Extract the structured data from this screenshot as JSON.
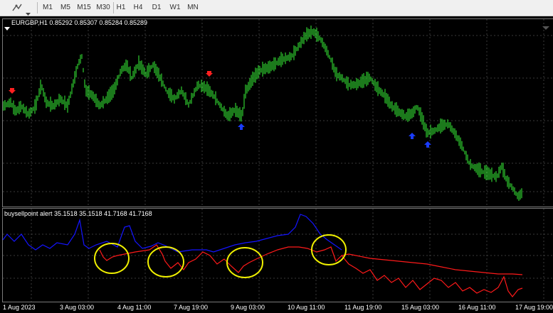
{
  "toolbar": {
    "timeframes": [
      "M1",
      "M5",
      "M15",
      "M30",
      "H1",
      "H4",
      "D1",
      "W1",
      "MN"
    ],
    "tools": [
      "draw-tools-icon",
      "chevron-down-icon"
    ]
  },
  "main_chart": {
    "symbol_info": "EURGBP,H1  0.85292 0.85307 0.85284 0.85289",
    "colors": {
      "candle": "#2ecc2e",
      "up_arrow": "#1a3cff",
      "down_arrow": "#ff2020",
      "grid": "#3a3a3a"
    }
  },
  "indicator": {
    "info": "buysellpoint alert 35.1518 35.1518 41.7168 41.7168",
    "colors": {
      "blue_line": "#1414ff",
      "red_line": "#ff1a1a",
      "circle": "#f0f000"
    }
  },
  "x_axis": {
    "labels": [
      "1 Aug 2023",
      "3 Aug 03:00",
      "4 Aug 11:00",
      "7 Aug 19:00",
      "9 Aug 03:00",
      "10 Aug 11:00",
      "11 Aug 19:00",
      "15 Aug 03:00",
      "16 Aug 11:00",
      "17 Aug 19:00"
    ]
  }
}
